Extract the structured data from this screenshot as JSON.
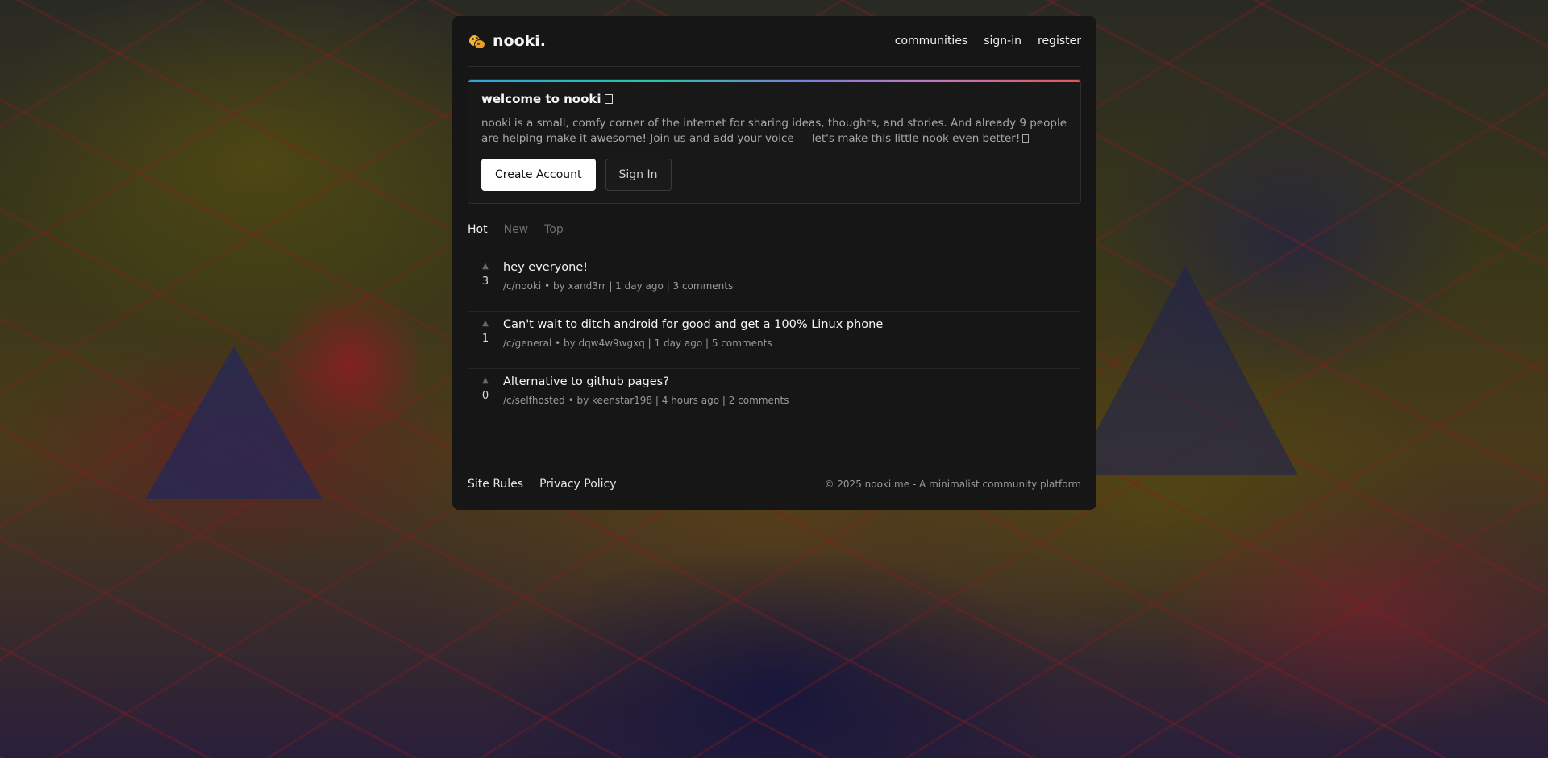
{
  "brand": {
    "name": "nooki."
  },
  "nav": {
    "communities": "communities",
    "sign_in": "sign-in",
    "register": "register"
  },
  "welcome": {
    "title": "welcome to nooki",
    "text": "nooki is a small, comfy corner of the internet for sharing ideas, thoughts, and stories. And already 9 people are helping make it awesome! Join us and add your voice — let's make this little nook even better!",
    "create_account": "Create Account",
    "sign_in": "Sign In"
  },
  "tabs": [
    {
      "label": "Hot",
      "active": true
    },
    {
      "label": "New",
      "active": false
    },
    {
      "label": "Top",
      "active": false
    }
  ],
  "posts": [
    {
      "votes": "3",
      "title": "hey everyone!",
      "community": "/c/nooki",
      "author": "by xand3rr",
      "time": "1 day ago",
      "comments": "3 comments"
    },
    {
      "votes": "1",
      "title": "Can't wait to ditch android for good and get a 100% Linux phone",
      "community": "/c/general",
      "author": "by dqw4w9wgxq",
      "time": "1 day ago",
      "comments": "5 comments"
    },
    {
      "votes": "0",
      "title": "Alternative to github pages?",
      "community": "/c/selfhosted",
      "author": "by keenstar198",
      "time": "4 hours ago",
      "comments": "2 comments"
    }
  ],
  "footer": {
    "site_rules": "Site Rules",
    "privacy_policy": "Privacy Policy",
    "copyright": "© 2025 nooki.me - A minimalist community platform"
  },
  "icons": {
    "brand": "cookie-icon",
    "upvote": "triangle-up-icon",
    "emoji_placeholder": "missing-glyph-icon"
  },
  "colors": {
    "accent_gradient": [
      "#2fa4d8",
      "#26c6a6",
      "#7a7dd8",
      "#c07ac0",
      "#e2555a"
    ],
    "panel": "#161616",
    "primary_button": "#ffffff"
  }
}
